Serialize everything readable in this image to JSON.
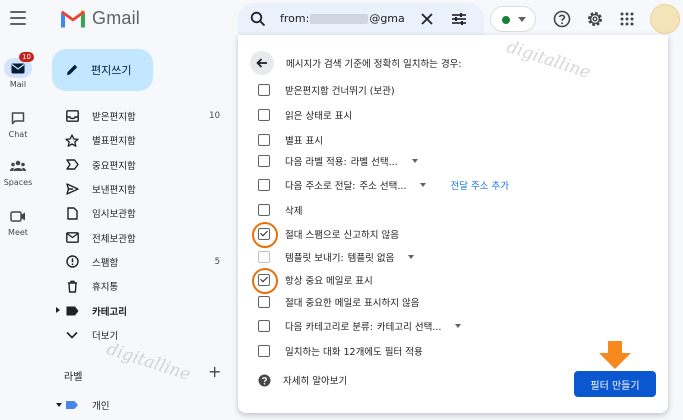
{
  "app": {
    "name": "Gmail"
  },
  "search": {
    "prefix": "from:",
    "suffix": "@gma"
  },
  "rail": [
    {
      "label": "Mail",
      "icon": "mail-icon",
      "badge": "10",
      "active": true
    },
    {
      "label": "Chat",
      "icon": "chat-icon"
    },
    {
      "label": "Spaces",
      "icon": "spaces-icon"
    },
    {
      "label": "Meet",
      "icon": "meet-icon"
    }
  ],
  "compose": {
    "label": "편지쓰기"
  },
  "nav": [
    {
      "label": "받은편지함",
      "icon": "inbox-icon",
      "count": "10"
    },
    {
      "label": "별표편지함",
      "icon": "star-icon"
    },
    {
      "label": "중요편지함",
      "icon": "important-icon"
    },
    {
      "label": "보낸편지함",
      "icon": "send-icon"
    },
    {
      "label": "임시보관함",
      "icon": "draft-icon"
    },
    {
      "label": "전체보관함",
      "icon": "all-mail-icon"
    },
    {
      "label": "스팸함",
      "icon": "spam-icon",
      "count": "5"
    },
    {
      "label": "휴지통",
      "icon": "trash-icon"
    },
    {
      "label": "카테고리",
      "icon": "category-icon",
      "bold": true
    },
    {
      "label": "더보기",
      "icon": "chevron-down-icon"
    }
  ],
  "labels": {
    "heading": "라벨",
    "items": [
      {
        "label": "개인",
        "color": "#4a86e8"
      }
    ]
  },
  "filter": {
    "title": "메시지가 검색 기준에 정확히 일치하는 경우:",
    "options": [
      {
        "label": "받은편지함 건너뛰기 (보관)",
        "checked": false
      },
      {
        "label": "읽은 상태로 표시",
        "checked": false
      },
      {
        "label": "별표 표시",
        "checked": false
      },
      {
        "label": "다음 라벨 적용:",
        "select": "라벨 선택...",
        "checked": false
      },
      {
        "label": "다음 주소로 전달:",
        "select": "주소 선택...",
        "link": "전달 주소 추가",
        "checked": false
      },
      {
        "label": "삭제",
        "checked": false
      },
      {
        "label": "절대 스팸으로 신고하지 않음",
        "checked": true,
        "highlight": true
      },
      {
        "label": "템플릿 보내기:",
        "select": "템플릿 없음",
        "checked": false,
        "disabled": true
      },
      {
        "label": "항상 중요 메일로 표시",
        "checked": true,
        "highlight": true
      },
      {
        "label": "절대 중요한 메일로 표시하지 않음",
        "checked": false
      },
      {
        "label": "다음 카테고리로 분류:",
        "select": "카테고리 선택...",
        "checked": false
      },
      {
        "label": "일치하는 대화 12개에도 필터 적용",
        "checked": false
      }
    ],
    "learn_more": "자세히 알아보기",
    "create_button": "필터 만들기"
  },
  "watermark": "digitalline",
  "colors": {
    "compose_bg": "#c2e7ff",
    "primary": "#0b57d0",
    "highlight_ring": "#e8710a",
    "badge": "#c5221f"
  }
}
